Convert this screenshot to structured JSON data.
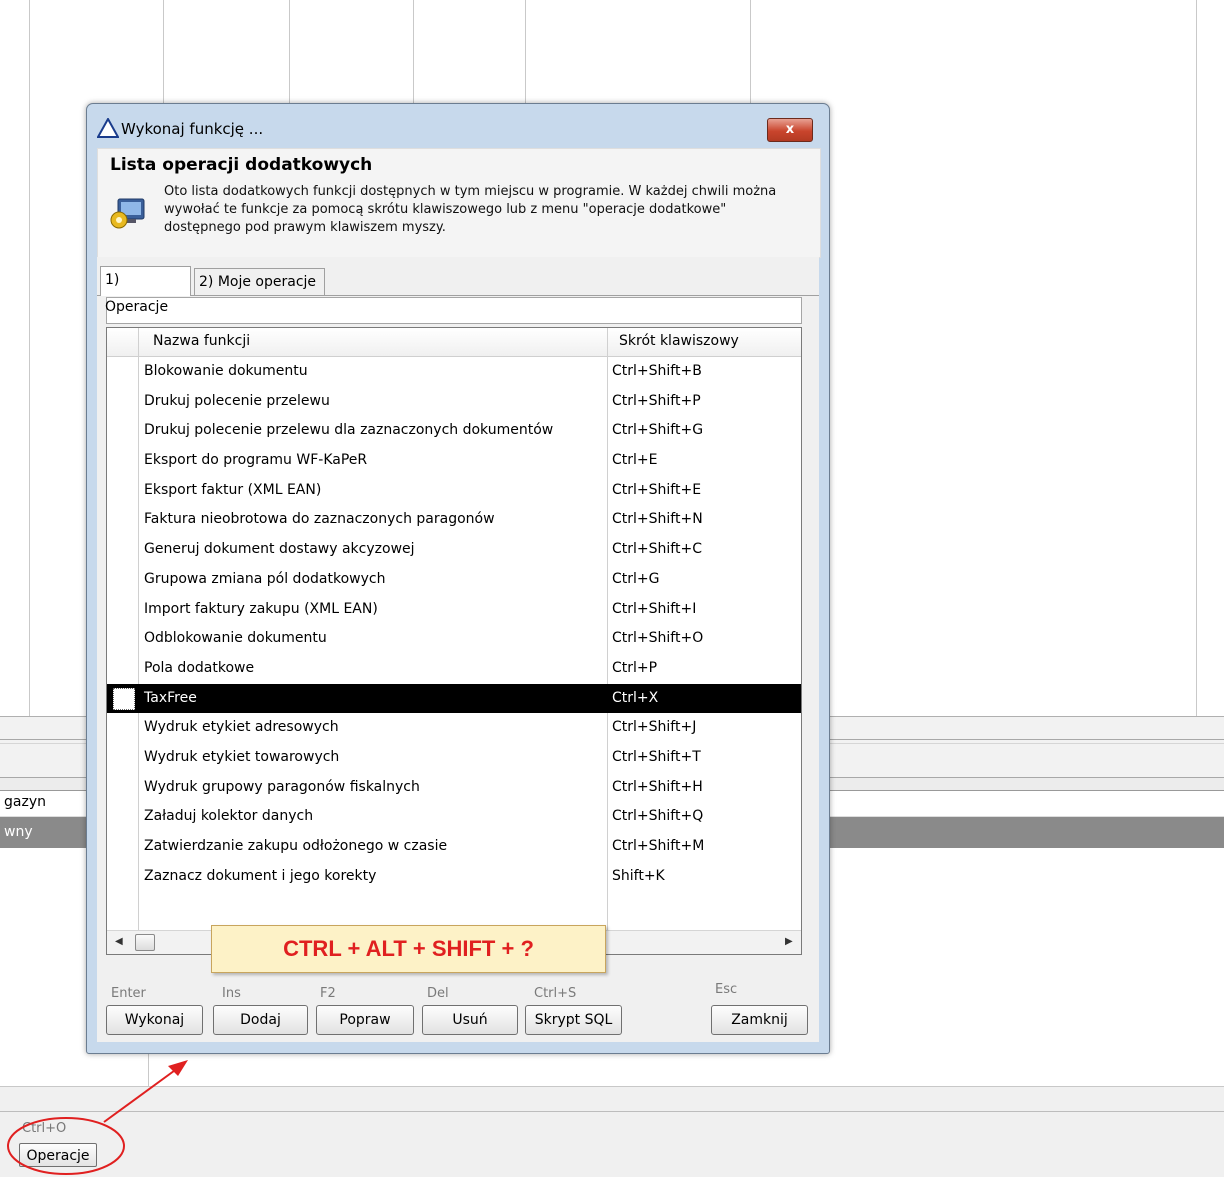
{
  "background": {
    "row_magazyn": "gazyn",
    "row_dark": "wny",
    "ctrl_hint": "Ctrl+O",
    "operacje_button": "Operacje"
  },
  "dialog": {
    "title": "Wykonaj funkcję ...",
    "close_label": "x",
    "header_title": "Lista operacji dodatkowych",
    "header_description": "Oto lista dodatkowych funkcji dostępnych w tym miejscu w programie. W każdej chwili można wywołać te funkcje za pomocą skrótu klawiszowego lub z menu \"operacje dodatkowe\" dostępnego pod prawym klawiszem myszy.",
    "tabs": [
      {
        "label": "1) Operacje"
      },
      {
        "label": "2) Moje operacje"
      }
    ],
    "search_value": "",
    "columns": {
      "name": "Nazwa funkcji",
      "shortcut": "Skrót klawiszowy"
    },
    "rows": [
      {
        "name": "Blokowanie dokumentu",
        "shortcut": "Ctrl+Shift+B"
      },
      {
        "name": "Drukuj polecenie przelewu",
        "shortcut": "Ctrl+Shift+P"
      },
      {
        "name": "Drukuj polecenie przelewu dla zaznaczonych dokumentów",
        "shortcut": "Ctrl+Shift+G"
      },
      {
        "name": "Eksport do programu WF-KaPeR",
        "shortcut": "Ctrl+E"
      },
      {
        "name": "Eksport faktur (XML EAN)",
        "shortcut": "Ctrl+Shift+E"
      },
      {
        "name": "Faktura nieobrotowa do zaznaczonych paragonów",
        "shortcut": "Ctrl+Shift+N"
      },
      {
        "name": "Generuj dokument dostawy akcyzowej",
        "shortcut": "Ctrl+Shift+C"
      },
      {
        "name": "Grupowa zmiana pól dodatkowych",
        "shortcut": "Ctrl+G"
      },
      {
        "name": "Import faktury zakupu (XML EAN)",
        "shortcut": "Ctrl+Shift+I"
      },
      {
        "name": "Odblokowanie dokumentu",
        "shortcut": "Ctrl+Shift+O"
      },
      {
        "name": "Pola dodatkowe",
        "shortcut": "Ctrl+P"
      },
      {
        "name": "TaxFree",
        "shortcut": "Ctrl+X"
      },
      {
        "name": "Wydruk etykiet adresowych",
        "shortcut": "Ctrl+Shift+J"
      },
      {
        "name": "Wydruk etykiet towarowych",
        "shortcut": "Ctrl+Shift+T"
      },
      {
        "name": "Wydruk grupowy paragonów fiskalnych",
        "shortcut": "Ctrl+Shift+H"
      },
      {
        "name": "Załaduj kolektor danych",
        "shortcut": "Ctrl+Shift+Q"
      },
      {
        "name": "Zatwierdzanie zakupu odłożonego w czasie",
        "shortcut": "Ctrl+Shift+M"
      },
      {
        "name": "Zaznacz dokument i jego korekty",
        "shortcut": "Shift+K"
      }
    ],
    "selected_row": "TaxFree",
    "footer": {
      "buttons": [
        {
          "hint": "Enter",
          "label": "Wykonaj"
        },
        {
          "hint": "Ins",
          "label": "Dodaj"
        },
        {
          "hint": "F2",
          "label": "Popraw"
        },
        {
          "hint": "Del",
          "label": "Usuń"
        },
        {
          "hint": "Ctrl+S",
          "label": "Skrypt SQL"
        },
        {
          "hint": "Esc",
          "label": "Zamknij"
        }
      ]
    }
  },
  "callout": {
    "text": "CTRL + ALT + SHIFT + ?",
    "text_color": "#e02020",
    "background": "#fdf2c7"
  },
  "annotation": {
    "color": "#e02020"
  },
  "colors": {
    "selection": "#000000",
    "dialog_frame": "#c7d9ec"
  }
}
